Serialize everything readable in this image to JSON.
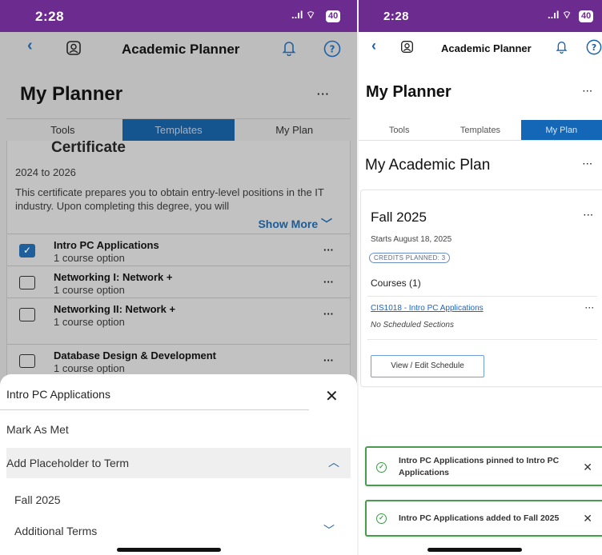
{
  "left": {
    "status": {
      "time": "2:28",
      "signal": "..ıl ⌔",
      "battery": "40"
    },
    "nav": {
      "back": "‹",
      "title": "Academic Planner"
    },
    "header": {
      "title": "My Planner",
      "more": "···"
    },
    "tabs": [
      "Tools",
      "Templates",
      "My Plan"
    ],
    "certificate": {
      "heading": "Certificate",
      "years": "2024 to 2026",
      "description": "This certificate prepares you to obtain entry-level positions in the IT industry. Upon completing this degree, you will",
      "show_more": "Show More ﹀"
    },
    "courses": [
      {
        "name": "Intro PC Applications",
        "options": "1 course option",
        "checked": true,
        "more": "···"
      },
      {
        "name": "Networking I: Network +",
        "options": "1 course option",
        "checked": false,
        "more": "···"
      },
      {
        "name": "Networking II: Network +",
        "options": "1 course option",
        "checked": false,
        "more": "···"
      },
      {
        "name": "Database Design & Development",
        "options": "1 course option",
        "checked": false,
        "more": "···"
      }
    ],
    "sheet": {
      "title": "Intro PC Applications",
      "close": "✕",
      "mark_met": "Mark As Met",
      "add_placeholder": "Add Placeholder to Term",
      "chevron_up": "︿",
      "term": "Fall 2025",
      "additional": "Additional Terms",
      "chevron_down": "﹀"
    }
  },
  "right": {
    "status": {
      "time": "2:28",
      "signal": "..ıl ⌔",
      "battery": "40"
    },
    "nav": {
      "back": "‹",
      "title": "Academic Planner"
    },
    "header": {
      "title": "My Planner",
      "more": "···"
    },
    "tabs": [
      "Tools",
      "Templates",
      "My Plan"
    ],
    "subtitle": "My Academic Plan",
    "subtitle_more": "···",
    "term": {
      "name": "Fall 2025",
      "more": "···",
      "starts": "Starts August 18, 2025",
      "credits": "CREDITS PLANNED: 3",
      "courses_heading": "Courses (1)",
      "course_link": "CIS1018 - Intro PC Applications",
      "course_more": "···",
      "no_sections": "No Scheduled Sections",
      "view_edit": "View / Edit Schedule"
    },
    "toasts": [
      {
        "message": "Intro PC Applications pinned to Intro PC Applications",
        "icon": "✓",
        "close": "✕"
      },
      {
        "message": "Intro PC Applications added to Fall 2025",
        "icon": "✓",
        "close": "✕"
      }
    ]
  },
  "colors": {
    "status_bar": "#6c2b8f",
    "accent": "#1467b6",
    "success": "#4b9a52"
  }
}
